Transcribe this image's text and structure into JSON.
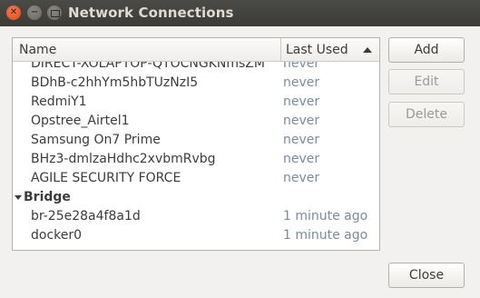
{
  "window": {
    "title": "Network Connections",
    "controls": {
      "close_glyph": "✕",
      "minimize_glyph": "−"
    }
  },
  "list": {
    "columns": {
      "name": "Name",
      "last_used": "Last Used"
    },
    "rows": [
      {
        "type": "item",
        "name": "DIRECT-XOLAPTOP-QTOCNGKNmsZM",
        "last_used": "never"
      },
      {
        "type": "item",
        "name": "BDhB-c2hhYm5hbTUzNzI5",
        "last_used": "never"
      },
      {
        "type": "item",
        "name": "RedmiY1",
        "last_used": "never"
      },
      {
        "type": "item",
        "name": "Opstree_Airtel1",
        "last_used": "never"
      },
      {
        "type": "item",
        "name": "Samsung On7 Prime",
        "last_used": "never"
      },
      {
        "type": "item",
        "name": "BHz3-dmlzaHdhc2xvbmRvbg",
        "last_used": "never"
      },
      {
        "type": "item",
        "name": "AGILE SECURITY FORCE",
        "last_used": "never"
      },
      {
        "type": "group",
        "name": "Bridge"
      },
      {
        "type": "item",
        "name": "br-25e28a4f8a1d",
        "last_used": "1 minute ago"
      },
      {
        "type": "item",
        "name": "docker0",
        "last_used": "1 minute ago"
      }
    ]
  },
  "buttons": {
    "add": "Add",
    "edit": "Edit",
    "delete": "Delete",
    "close": "Close"
  },
  "icons": {
    "sort": "sort-ascending-icon",
    "expander": "expander-down-icon"
  }
}
